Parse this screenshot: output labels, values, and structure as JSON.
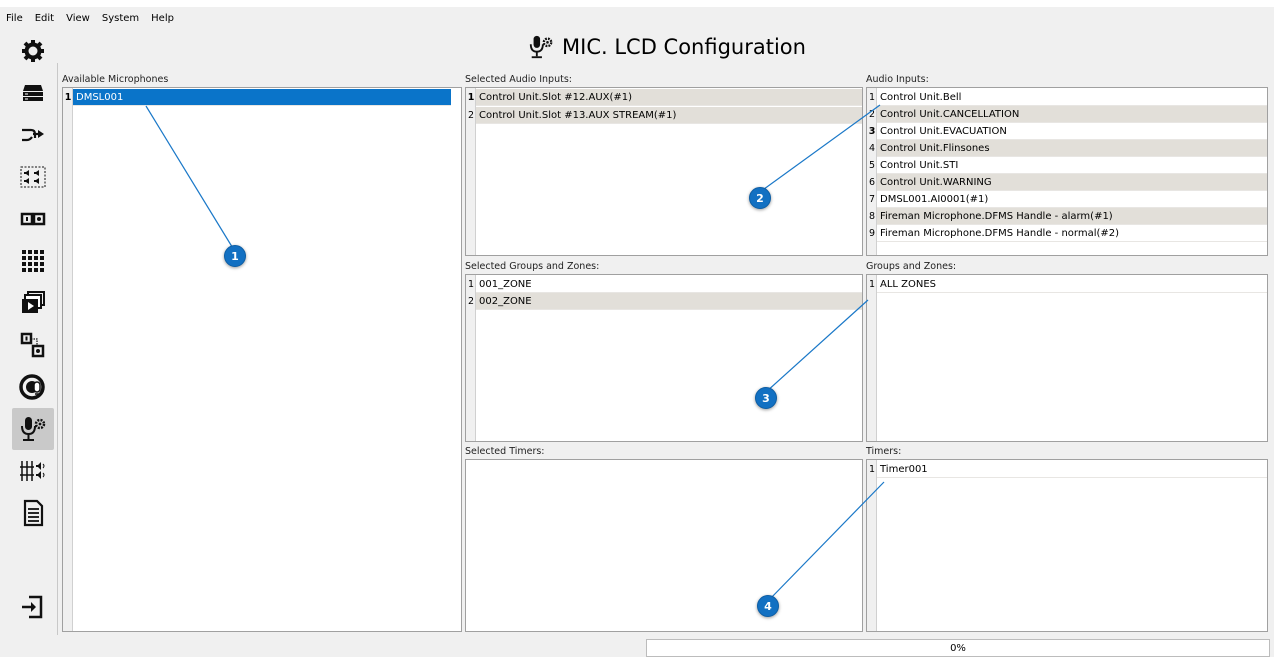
{
  "menu": [
    "File",
    "Edit",
    "View",
    "System",
    "Help"
  ],
  "title": "MIC. LCD Configuration",
  "sidebar": {
    "items": [
      {
        "icon": "gear-icon"
      },
      {
        "icon": "server-icon"
      },
      {
        "icon": "routing-icon"
      },
      {
        "icon": "speakers-icon"
      },
      {
        "icon": "io-icon"
      },
      {
        "icon": "grid-icon"
      },
      {
        "icon": "media-icon"
      },
      {
        "icon": "connect-icon"
      },
      {
        "icon": "dial-mic-icon"
      },
      {
        "icon": "mic-config-icon",
        "active": true
      },
      {
        "icon": "mixer-icon"
      },
      {
        "icon": "document-icon"
      },
      {
        "icon": "logout-icon"
      }
    ]
  },
  "panels": {
    "available_microphones": {
      "label": "Available Microphones",
      "items": [
        {
          "num": "1",
          "text": "DMSL001"
        }
      ]
    },
    "selected_audio_inputs": {
      "label": "Selected Audio Inputs:",
      "items": [
        {
          "num": "1",
          "text": "Control Unit.Slot #12.AUX(#1)"
        },
        {
          "num": "2",
          "text": "Control Unit.Slot #13.AUX STREAM(#1)"
        }
      ]
    },
    "audio_inputs": {
      "label": "Audio Inputs:",
      "items": [
        {
          "num": "1",
          "text": "Control Unit.Bell"
        },
        {
          "num": "2",
          "text": "Control Unit.CANCELLATION"
        },
        {
          "num": "3",
          "text": "Control Unit.EVACUATION"
        },
        {
          "num": "4",
          "text": "Control Unit.Flinsones"
        },
        {
          "num": "5",
          "text": "Control Unit.STI"
        },
        {
          "num": "6",
          "text": "Control Unit.WARNING"
        },
        {
          "num": "7",
          "text": "DMSL001.AI0001(#1)"
        },
        {
          "num": "8",
          "text": "Fireman Microphone.DFMS Handle - alarm(#1)"
        },
        {
          "num": "9",
          "text": "Fireman Microphone.DFMS Handle - normal(#2)"
        }
      ]
    },
    "selected_groups_zones": {
      "label": "Selected Groups and Zones:",
      "items": [
        {
          "num": "1",
          "text": "001_ZONE"
        },
        {
          "num": "2",
          "text": "002_ZONE"
        }
      ]
    },
    "groups_zones": {
      "label": "Groups and Zones:",
      "items": [
        {
          "num": "1",
          "text": "ALL ZONES"
        }
      ]
    },
    "selected_timers": {
      "label": "Selected Timers:",
      "items": []
    },
    "timers": {
      "label": "Timers:",
      "items": [
        {
          "num": "1",
          "text": "Timer001"
        }
      ]
    }
  },
  "callouts": [
    "1",
    "2",
    "3",
    "4"
  ],
  "progress": {
    "text": "0%",
    "value": 0
  },
  "colors": {
    "selection": "#0a74c9",
    "callout": "#1270c2",
    "alt_row": "#e2dfd9"
  }
}
